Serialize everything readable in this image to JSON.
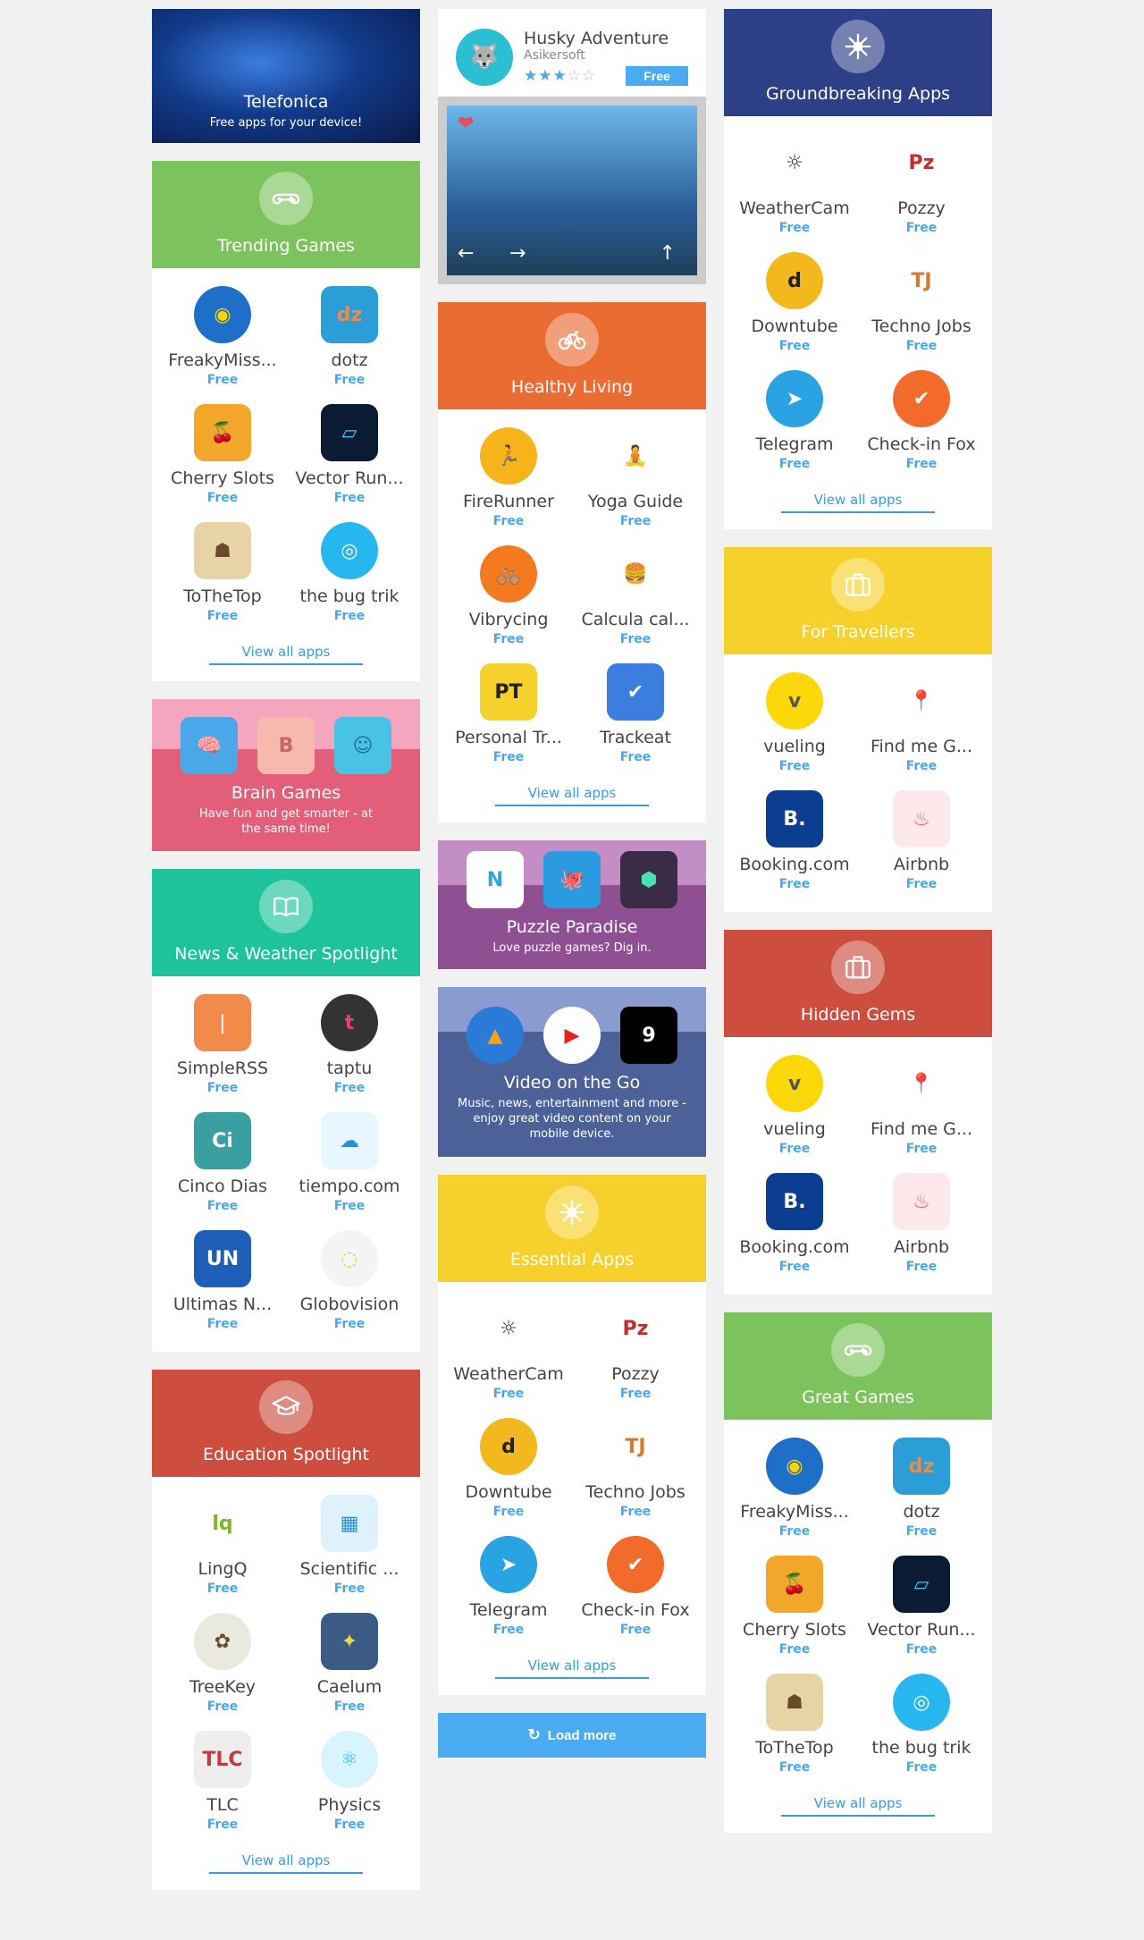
{
  "telefonica": {
    "title": "Telefonica",
    "subtitle": "Free apps for your device!"
  },
  "trending": {
    "title": "Trending Games",
    "color": "#7dc35d",
    "apps": [
      {
        "name": "FreakyMiss...",
        "price": "Free",
        "icon": "freaky-mission-icon"
      },
      {
        "name": "dotz",
        "price": "Free",
        "icon": "dotz-icon"
      },
      {
        "name": "Cherry Slots",
        "price": "Free",
        "icon": "cherry-slots-icon"
      },
      {
        "name": "Vector Run...",
        "price": "Free",
        "icon": "vector-runner-icon"
      },
      {
        "name": "ToTheTop",
        "price": "Free",
        "icon": "tothetop-icon"
      },
      {
        "name": "the bug trik",
        "price": "Free",
        "icon": "bug-trik-icon"
      }
    ],
    "view_all": "View all apps"
  },
  "brain": {
    "title": "Brain Games",
    "subtitle": "Have fun and get smarter - at the same time!",
    "color": "#e35e79"
  },
  "news": {
    "title": "News & Weather Spotlight",
    "color": "#1ec39c",
    "apps": [
      {
        "name": "SimpleRSS",
        "price": "Free",
        "icon": "rss-icon"
      },
      {
        "name": "taptu",
        "price": "Free",
        "icon": "taptu-icon"
      },
      {
        "name": "Cinco Dias",
        "price": "Free",
        "icon": "cinco-dias-icon"
      },
      {
        "name": "tiempo.com",
        "price": "Free",
        "icon": "tiempo-icon"
      },
      {
        "name": "Ultimas N...",
        "price": "Free",
        "icon": "ultimas-noticias-icon"
      },
      {
        "name": "Globovision",
        "price": "Free",
        "icon": "globovision-icon"
      }
    ]
  },
  "education": {
    "title": "Education Spotlight",
    "color": "#cd4e3e",
    "apps": [
      {
        "name": "LingQ",
        "price": "Free",
        "icon": "lingq-icon"
      },
      {
        "name": "Scientific ...",
        "price": "Free",
        "icon": "calculator-icon"
      },
      {
        "name": "TreeKey",
        "price": "Free",
        "icon": "treekey-icon"
      },
      {
        "name": "Caelum",
        "price": "Free",
        "icon": "caelum-icon"
      },
      {
        "name": "TLC",
        "price": "Free",
        "icon": "tlc-icon"
      },
      {
        "name": "Physics",
        "price": "Free",
        "icon": "physics-icon"
      }
    ],
    "view_all": "View all apps"
  },
  "featured": {
    "name": "Husky Adventure",
    "developer": "Asikersoft",
    "price": "Free",
    "rating": 3
  },
  "healthy": {
    "title": "Healthy Living",
    "color": "#ea6c33",
    "apps": [
      {
        "name": "FireRunner",
        "price": "Free",
        "icon": "firerunner-icon"
      },
      {
        "name": "Yoga Guide",
        "price": "Free",
        "icon": "yoga-icon"
      },
      {
        "name": "Vibrycing",
        "price": "Free",
        "icon": "bicycle-icon"
      },
      {
        "name": "Calcula cal...",
        "price": "Free",
        "icon": "burger-icon"
      },
      {
        "name": "Personal Tr...",
        "price": "Free",
        "icon": "personal-trainer-icon"
      },
      {
        "name": "Trackeat",
        "price": "Free",
        "icon": "trackeat-icon"
      }
    ],
    "view_all": "View all apps"
  },
  "puzzle": {
    "title": "Puzzle Paradise",
    "subtitle": "Love puzzle games? Dig in.",
    "color": "#8e4f93"
  },
  "video": {
    "title": "Video on the Go",
    "subtitle": "Music, news, entertainment and more - enjoy great video content on your mobile device.",
    "color": "#4d6199"
  },
  "essential": {
    "title": "Essential Apps",
    "color": "#f7d12b",
    "apps": [
      {
        "name": "WeatherCam",
        "price": "Free",
        "icon": "weathercam-icon"
      },
      {
        "name": "Pozzy",
        "price": "Free",
        "icon": "pozzy-icon"
      },
      {
        "name": "Downtube",
        "price": "Free",
        "icon": "downtube-icon"
      },
      {
        "name": "Techno Jobs",
        "price": "Free",
        "icon": "techno-jobs-icon"
      },
      {
        "name": "Telegram",
        "price": "Free",
        "icon": "telegram-icon"
      },
      {
        "name": "Check-in Fox",
        "price": "Free",
        "icon": "checkin-fox-icon"
      }
    ],
    "view_all": "View all apps"
  },
  "load_more": "Load more",
  "groundbreaking": {
    "title": "Groundbreaking Apps",
    "color": "#2c3f87",
    "apps": [
      {
        "name": "WeatherCam",
        "price": "Free",
        "icon": "weathercam-icon"
      },
      {
        "name": "Pozzy",
        "price": "Free",
        "icon": "pozzy-icon"
      },
      {
        "name": "Downtube",
        "price": "Free",
        "icon": "downtube-icon"
      },
      {
        "name": "Techno Jobs",
        "price": "Free",
        "icon": "techno-jobs-icon"
      },
      {
        "name": "Telegram",
        "price": "Free",
        "icon": "telegram-icon"
      },
      {
        "name": "Check-in Fox",
        "price": "Free",
        "icon": "checkin-fox-icon"
      }
    ],
    "view_all": "View all apps"
  },
  "travellers": {
    "title": "For Travellers",
    "color": "#f7d12b",
    "apps": [
      {
        "name": "vueling",
        "price": "Free",
        "icon": "vueling-icon"
      },
      {
        "name": "Find me G...",
        "price": "Free",
        "icon": "map-pin-icon"
      },
      {
        "name": "Booking.com",
        "price": "Free",
        "icon": "booking-icon"
      },
      {
        "name": "Airbnb",
        "price": "Free",
        "icon": "airbnb-icon"
      }
    ]
  },
  "hidden": {
    "title": "Hidden Gems",
    "color": "#cd4e3e",
    "apps": [
      {
        "name": "vueling",
        "price": "Free",
        "icon": "vueling-icon"
      },
      {
        "name": "Find me G...",
        "price": "Free",
        "icon": "map-pin-icon"
      },
      {
        "name": "Booking.com",
        "price": "Free",
        "icon": "booking-icon"
      },
      {
        "name": "Airbnb",
        "price": "Free",
        "icon": "airbnb-icon"
      }
    ]
  },
  "great": {
    "title": "Great Games",
    "color": "#7dc35d",
    "apps": [
      {
        "name": "FreakyMiss...",
        "price": "Free",
        "icon": "freaky-mission-icon"
      },
      {
        "name": "dotz",
        "price": "Free",
        "icon": "dotz-icon"
      },
      {
        "name": "Cherry Slots",
        "price": "Free",
        "icon": "cherry-slots-icon"
      },
      {
        "name": "Vector Run...",
        "price": "Free",
        "icon": "vector-runner-icon"
      },
      {
        "name": "ToTheTop",
        "price": "Free",
        "icon": "tothetop-icon"
      },
      {
        "name": "the bug trik",
        "price": "Free",
        "icon": "bug-trik-icon"
      }
    ],
    "view_all": "View all apps"
  }
}
